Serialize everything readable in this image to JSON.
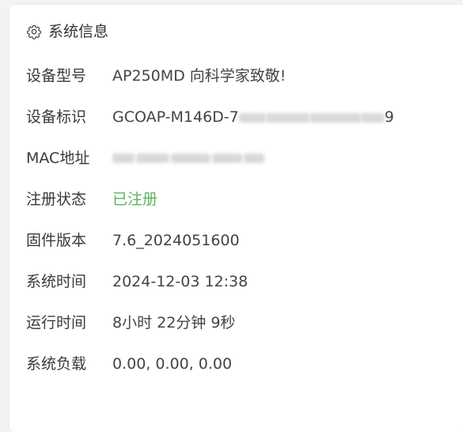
{
  "panel": {
    "title": "系统信息",
    "icon": "gear-icon"
  },
  "rows": [
    {
      "label": "设备型号",
      "value": "AP250MD 向科学家致敬!"
    },
    {
      "label": "设备标识",
      "value_prefix": "GCOAP-M146D-7",
      "value_suffix": "9"
    },
    {
      "label": "MAC地址",
      "value": ""
    },
    {
      "label": "注册状态",
      "value": "已注册",
      "color": "#5ab45f"
    },
    {
      "label": "固件版本",
      "value": "7.6_2024051600"
    },
    {
      "label": "系统时间",
      "value": "2024-12-03 12:38"
    },
    {
      "label": "运行时间",
      "value": "8小时 22分钟 9秒"
    },
    {
      "label": "系统负载",
      "value": "0.00, 0.00, 0.00"
    }
  ]
}
